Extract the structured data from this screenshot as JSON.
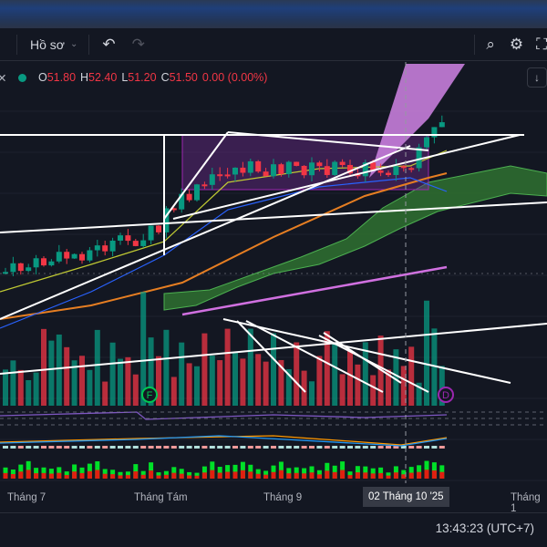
{
  "toolbar": {
    "profile_label": "Hồ sơ",
    "undo": "↶",
    "redo": "↷"
  },
  "legend": {
    "o_label": "O",
    "o": "51.80",
    "h_label": "H",
    "h": "52.40",
    "l_label": "L",
    "l": "51.20",
    "c_label": "C",
    "c": "51.50",
    "change": "0.00 (0.00%)"
  },
  "markers": {
    "f": "F",
    "d": "D"
  },
  "time_axis": {
    "labels": [
      "Tháng 7",
      "Tháng Tám",
      "Tháng 9",
      "Tháng 1"
    ],
    "current": "02 Tháng 10 '25"
  },
  "status": {
    "clock": "13:43:23 (UTC+7)"
  },
  "colors": {
    "up": "#089981",
    "down": "#f23645",
    "bg": "#131722",
    "cloud": "#2e7d32",
    "violet": "#c77dda"
  }
}
